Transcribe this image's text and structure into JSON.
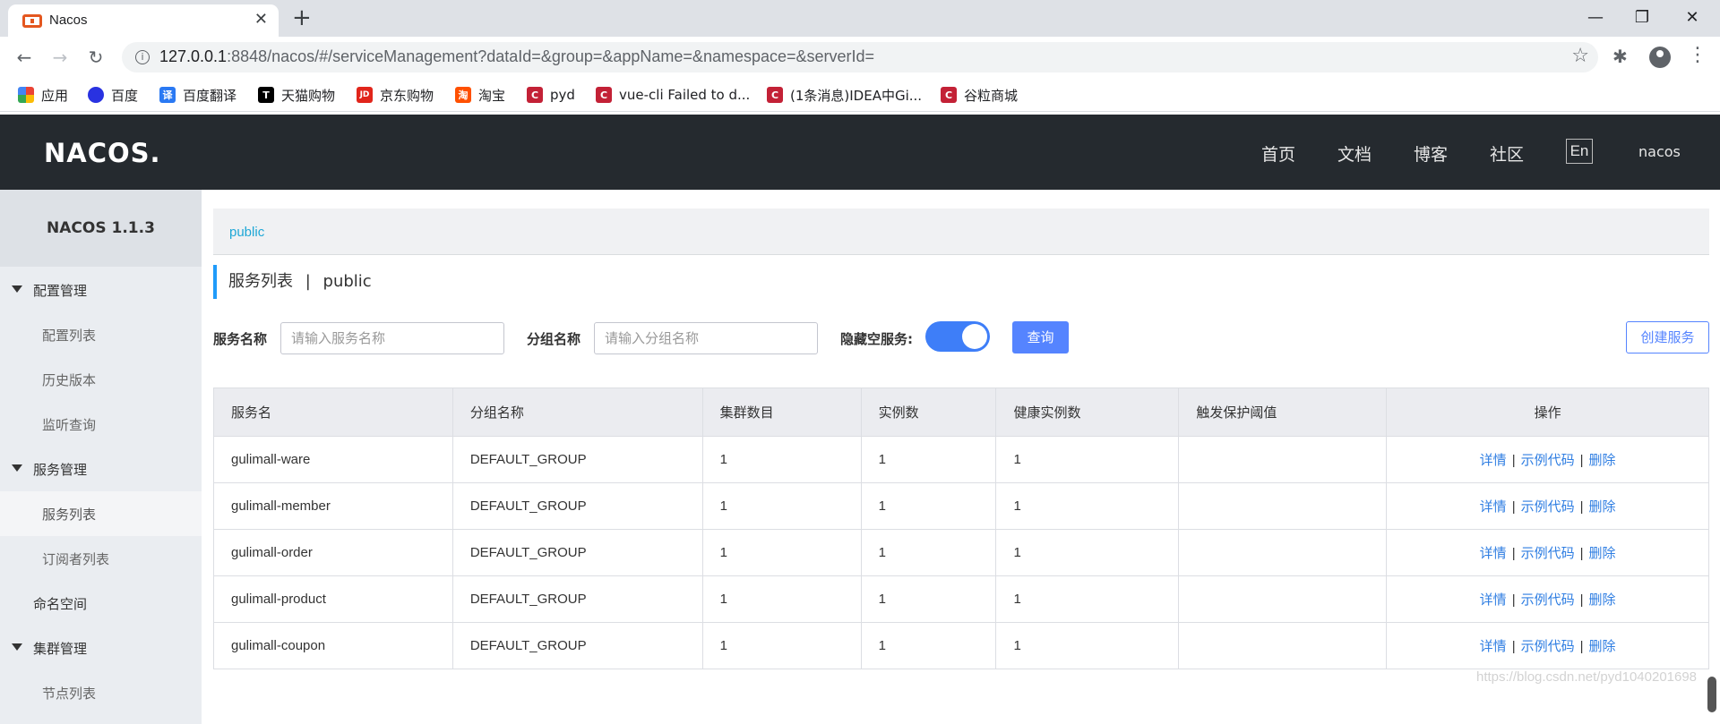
{
  "browser": {
    "tab_title": "Nacos",
    "url_host": "127.0.0.1",
    "url_rest": ":8848/nacos/#/serviceManagement?dataId=&group=&appName=&namespace=&serverId=",
    "bookmarks": [
      {
        "label": "应用",
        "icon": "apps-grid-icon",
        "color": "#ea4335"
      },
      {
        "label": "百度",
        "icon": "baidu-paw-icon",
        "color": "#2932e1"
      },
      {
        "label": "百度翻译",
        "icon": "translate-icon",
        "color": "#2a79f3",
        "glyph": "译"
      },
      {
        "label": "天猫购物",
        "icon": "tmall-icon",
        "color": "#000000",
        "glyph": "T"
      },
      {
        "label": "京东购物",
        "icon": "jd-icon",
        "color": "#e1251b",
        "glyph": "JD"
      },
      {
        "label": "淘宝",
        "icon": "taobao-icon",
        "color": "#ff5000",
        "glyph": "淘"
      },
      {
        "label": "pyd",
        "icon": "csdn-icon",
        "color": "#c32136",
        "glyph": "C"
      },
      {
        "label": "vue-cli Failed to d...",
        "icon": "csdn-icon",
        "color": "#c32136",
        "glyph": "C"
      },
      {
        "label": "(1条消息)IDEA中Gi...",
        "icon": "csdn-icon",
        "color": "#c32136",
        "glyph": "C"
      },
      {
        "label": "谷粒商城",
        "icon": "csdn-icon",
        "color": "#c32136",
        "glyph": "C"
      }
    ]
  },
  "header": {
    "logo": "NACOS.",
    "nav": [
      "首页",
      "文档",
      "博客",
      "社区"
    ],
    "lang": "En",
    "user": "nacos"
  },
  "sidebar": {
    "version": "NACOS 1.1.3",
    "groups": [
      {
        "label": "配置管理",
        "items": [
          "配置列表",
          "历史版本",
          "监听查询"
        ]
      },
      {
        "label": "服务管理",
        "items": [
          "服务列表",
          "订阅者列表"
        ]
      },
      {
        "label": "命名空间",
        "items": []
      },
      {
        "label": "集群管理",
        "items": [
          "节点列表"
        ]
      }
    ],
    "active_item": "服务列表"
  },
  "main": {
    "namespace_tab": "public",
    "title": "服务列表",
    "title_sep": "|",
    "title_ns": "public",
    "filters": {
      "service_label": "服务名称",
      "service_placeholder": "请输入服务名称",
      "group_label": "分组名称",
      "group_placeholder": "请输入分组名称",
      "hide_empty_label": "隐藏空服务:",
      "hide_empty_on": true,
      "query_button": "查询",
      "create_button": "创建服务"
    },
    "table": {
      "headers": [
        "服务名",
        "分组名称",
        "集群数目",
        "实例数",
        "健康实例数",
        "触发保护阈值",
        "操作"
      ],
      "rows": [
        {
          "name": "gulimall-ware",
          "group": "DEFAULT_GROUP",
          "clusters": "1",
          "instances": "1",
          "healthy": "1",
          "threshold": ""
        },
        {
          "name": "gulimall-member",
          "group": "DEFAULT_GROUP",
          "clusters": "1",
          "instances": "1",
          "healthy": "1",
          "threshold": ""
        },
        {
          "name": "gulimall-order",
          "group": "DEFAULT_GROUP",
          "clusters": "1",
          "instances": "1",
          "healthy": "1",
          "threshold": ""
        },
        {
          "name": "gulimall-product",
          "group": "DEFAULT_GROUP",
          "clusters": "1",
          "instances": "1",
          "healthy": "1",
          "threshold": ""
        },
        {
          "name": "gulimall-coupon",
          "group": "DEFAULT_GROUP",
          "clusters": "1",
          "instances": "1",
          "healthy": "1",
          "threshold": ""
        }
      ],
      "actions": [
        "详情",
        "示例代码",
        "删除"
      ],
      "action_sep": "|"
    }
  },
  "watermark": "https://blog.csdn.net/pyd1040201698"
}
